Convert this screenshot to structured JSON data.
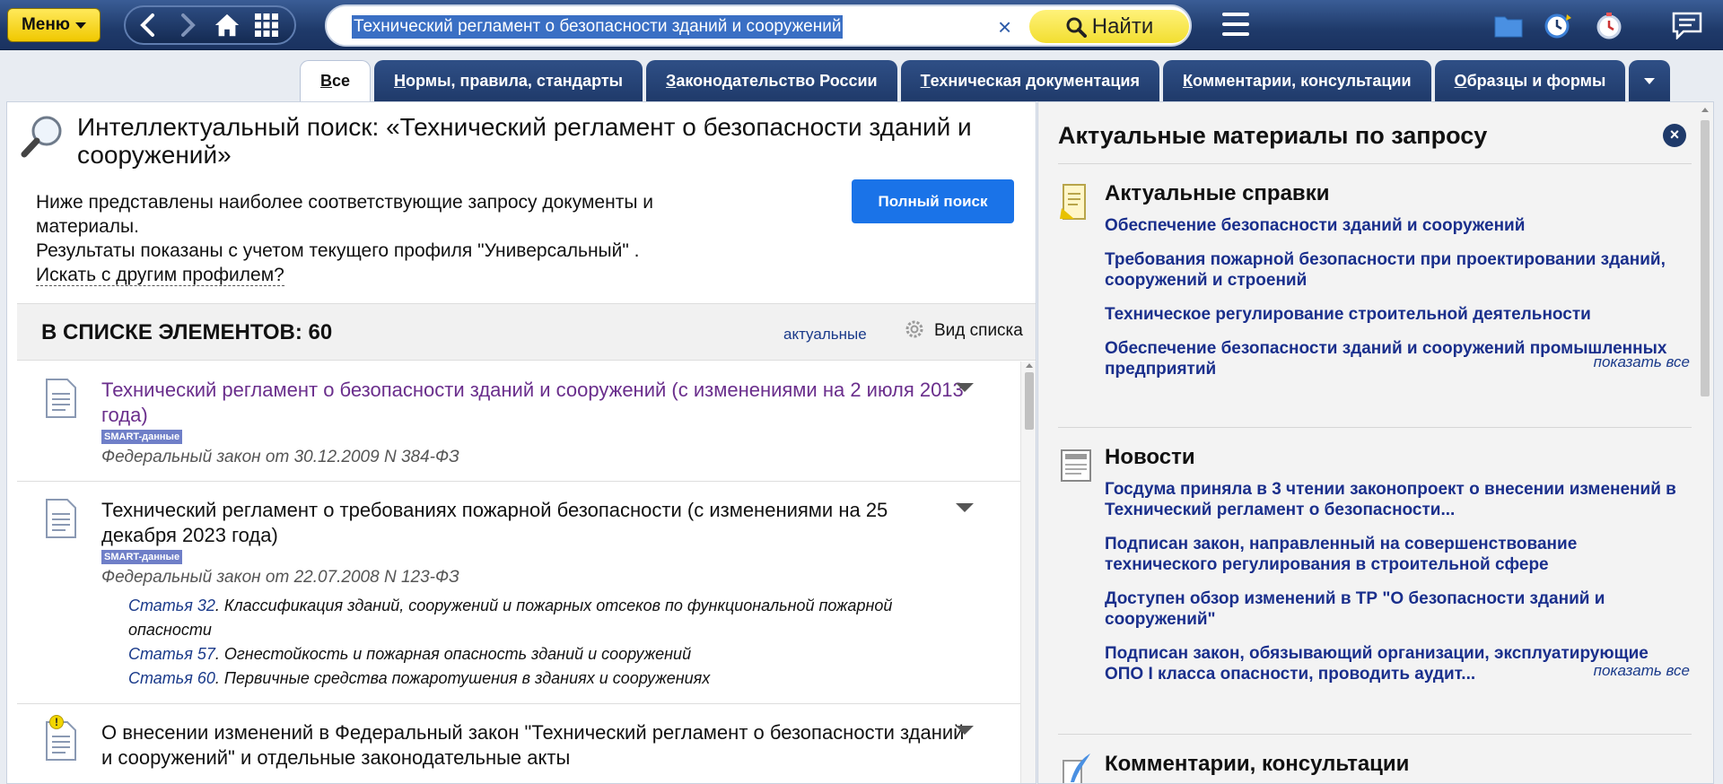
{
  "topbar": {
    "menu_label": "Меню",
    "search_value": "Технический регламент о безопасности зданий и сооружений",
    "clear_label": "×",
    "find_label": "Найти"
  },
  "tabs": [
    {
      "prefix": "В",
      "rest": "се"
    },
    {
      "prefix": "Н",
      "rest": "ормы, правила, стандарты"
    },
    {
      "prefix": "З",
      "rest": "аконодательство России"
    },
    {
      "prefix": "Т",
      "rest": "ехническая документация"
    },
    {
      "prefix": "К",
      "rest": "омментарии, консультации"
    },
    {
      "prefix": "О",
      "rest": "бразцы и формы"
    }
  ],
  "search": {
    "title": "Интеллектуальный поиск: «Технический регламент о безопасности зданий и сооружений»",
    "intro_line1": "Ниже представлены наиболее соответствующие запросу документы и материалы.",
    "intro_line2": "Результаты показаны с учетом текущего профиля \"Универсальный\" .",
    "other_profile": "Искать с другим профилем?",
    "full_search_label": "Полный поиск"
  },
  "list": {
    "count_label": "В СПИСКЕ ЭЛЕМЕНТОВ: 60",
    "filter_label": "актуальные",
    "view_label": "Вид списка"
  },
  "results": [
    {
      "title": "Технический регламент о безопасности зданий и сооружений (с изменениями на 2 июля 2013 года)",
      "badge": "SMART-данные",
      "subtitle": "Федеральный закон от 30.12.2009 N 384-ФЗ"
    },
    {
      "title": "Технический регламент о требованиях пожарной безопасности (с изменениями на 25 декабря 2023 года)",
      "badge": "SMART-данные",
      "subtitle": "Федеральный закон от 22.07.2008 N 123-ФЗ",
      "articles": [
        {
          "link": "Статья 32",
          "text": ". Классификация зданий, сооружений и пожарных отсеков по функциональной пожарной опасности"
        },
        {
          "link": "Статья 57",
          "text": ". Огнестойкость и пожарная опасность зданий и сооружений"
        },
        {
          "link": "Статья 60",
          "text": ". Первичные средства пожаротушения в зданиях и сооружениях"
        }
      ]
    },
    {
      "title": "О внесении изменений в Федеральный закон \"Технический регламент о безопасности зданий и сооружений\" и отдельные законодательные акты",
      "warning": "!"
    }
  ],
  "right": {
    "title": "Актуальные материалы по запросу",
    "close_label": "×",
    "sections": [
      {
        "title": "Актуальные справки",
        "links": [
          "Обеспечение безопасности зданий и сооружений",
          "Требования пожарной безопасности при проектировании зданий, сооружений и строений",
          "Техническое регулирование строительной деятельности",
          "Обеспечение безопасности зданий и сооружений промышленных предприятий"
        ],
        "show_all": "показать все"
      },
      {
        "title": "Новости",
        "links": [
          "Госдума приняла в 3 чтении законопроект о внесении изменений в Технический регламент о безопасности...",
          "Подписан закон, направленный на совершенствование технического регулирования в строительной сфере",
          "Доступен обзор изменений в ТР \"О безопасности зданий и сооружений\"",
          "Подписан закон, обязывающий организации, эксплуатирующие ОПО I класса опасности, проводить аудит..."
        ],
        "show_all": "показать все"
      },
      {
        "title": "Комментарии, консультации"
      }
    ]
  }
}
